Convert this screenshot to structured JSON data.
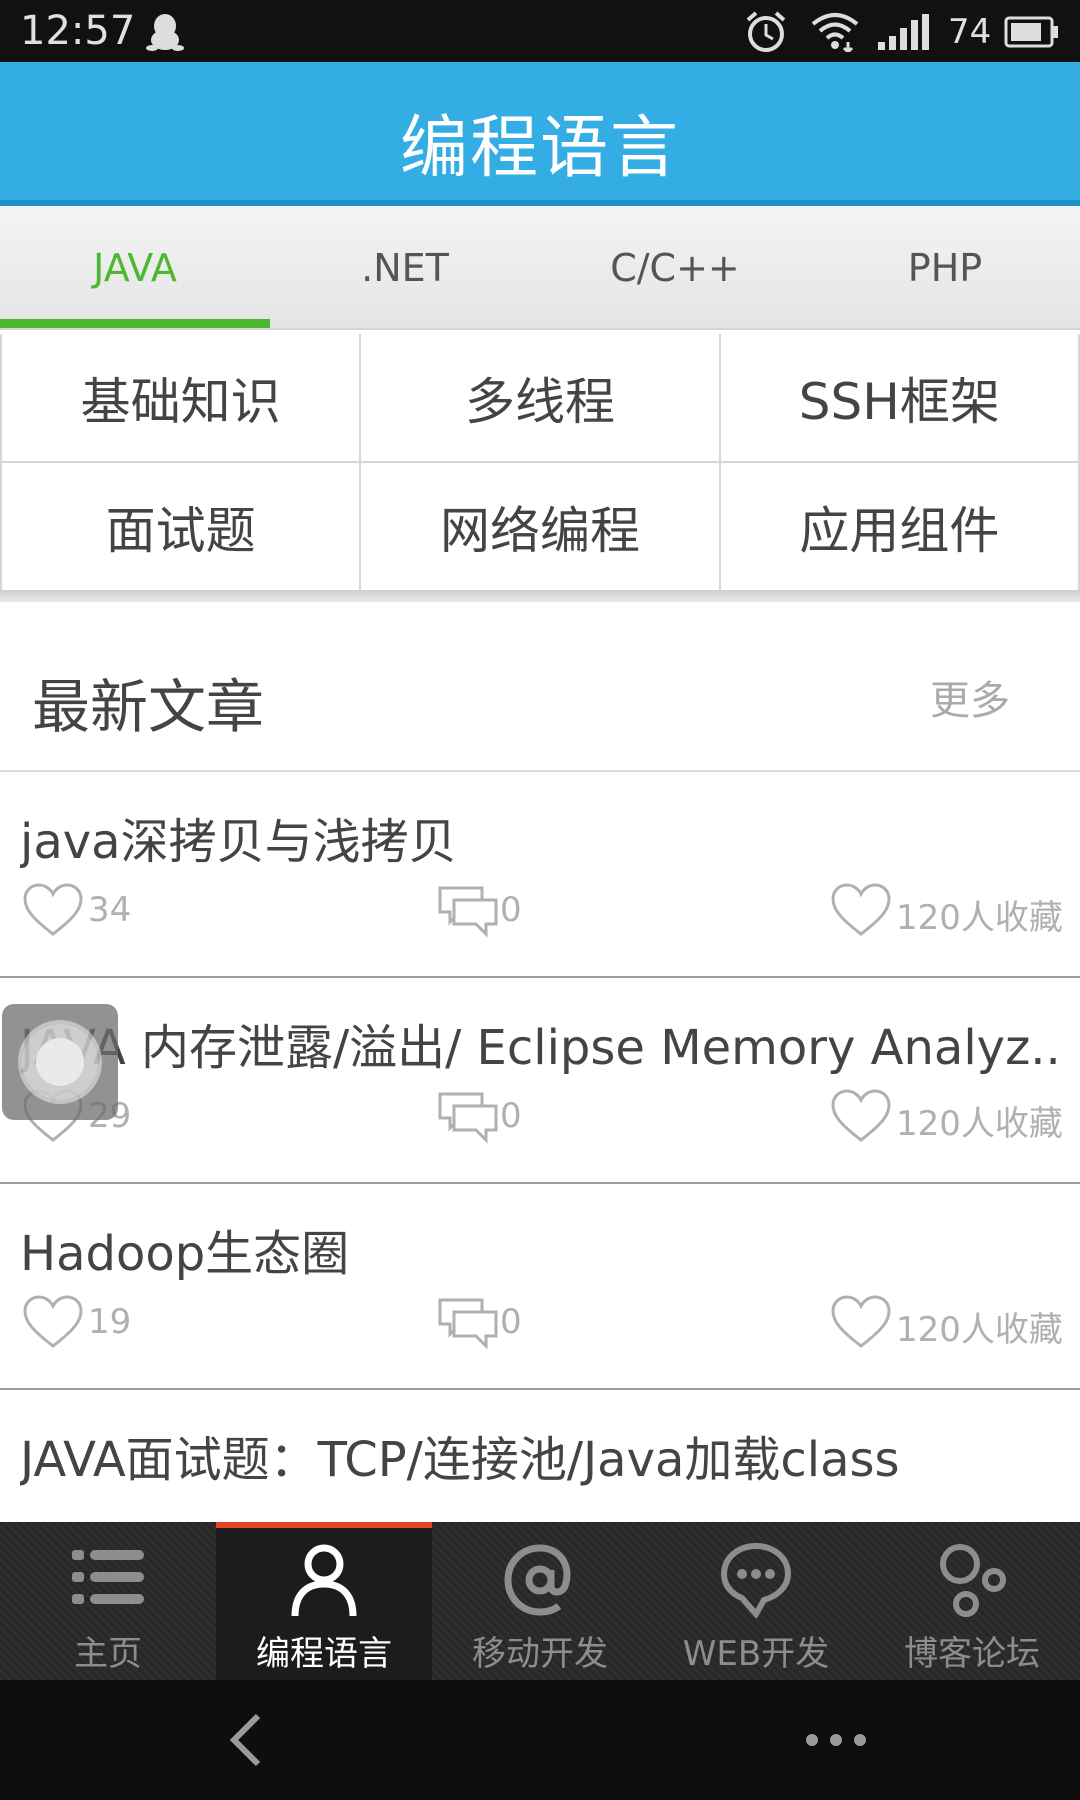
{
  "status_bar": {
    "time": "12:57",
    "battery": "74"
  },
  "header": {
    "title": "编程语言"
  },
  "lang_tabs": [
    {
      "label": "JAVA",
      "active": true
    },
    {
      "label": ".NET",
      "active": false
    },
    {
      "label": "C/C++",
      "active": false
    },
    {
      "label": "PHP",
      "active": false
    }
  ],
  "categories": [
    "基础知识",
    "多线程",
    "SSH框架",
    "面试题",
    "网络编程",
    "应用组件"
  ],
  "latest": {
    "title": "最新文章",
    "more": "更多"
  },
  "articles": [
    {
      "title": "java深拷贝与浅拷贝",
      "likes": "34",
      "comments": "0",
      "favorites": "120人收藏"
    },
    {
      "title": "JAVA  内存泄露/溢出/ Eclipse Memory Analyz..",
      "likes": "29",
      "comments": "0",
      "favorites": "120人收藏"
    },
    {
      "title": "Hadoop生态圈",
      "likes": "19",
      "comments": "0",
      "favorites": "120人收藏"
    },
    {
      "title": "JAVA面试题：TCP/连接池/Java加载class",
      "likes": "",
      "comments": "",
      "favorites": ""
    }
  ],
  "bottom_nav": [
    {
      "label": "主页",
      "icon": "list-icon",
      "active": false
    },
    {
      "label": "编程语言",
      "icon": "person-icon",
      "active": true
    },
    {
      "label": "移动开发",
      "icon": "at-icon",
      "active": false
    },
    {
      "label": "WEB开发",
      "icon": "chat-bubble-icon",
      "active": false
    },
    {
      "label": "博客论坛",
      "icon": "circles-icon",
      "active": false
    }
  ],
  "colors": {
    "header": "#33ade3",
    "active_tab": "#4cb82f",
    "nav_active_indicator": "#e2452b"
  }
}
